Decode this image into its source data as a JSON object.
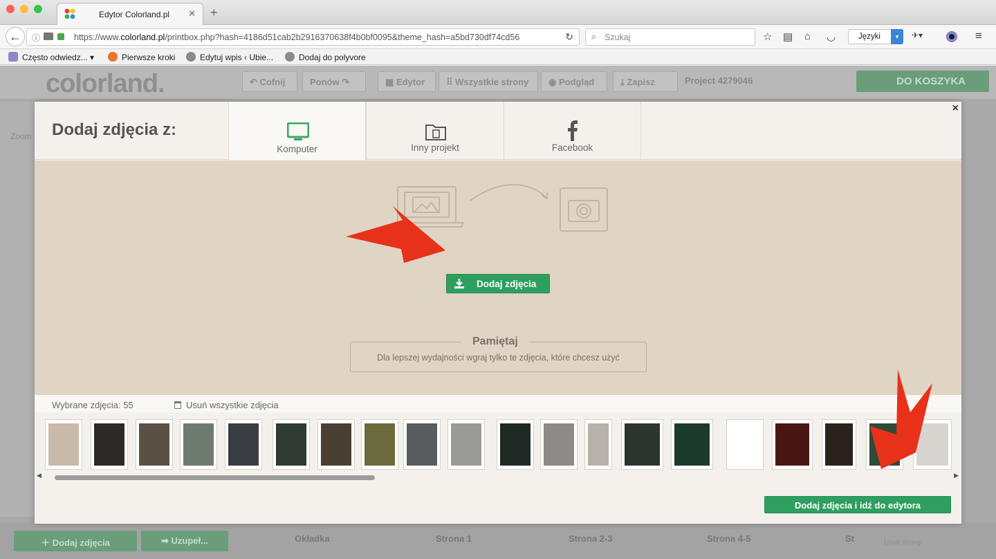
{
  "browser": {
    "tab_title": "Edytor Colorland.pl",
    "url_prefix": "https://www.",
    "url_host": "colorland.pl",
    "url_rest": "/printbox.php?hash=4186d51cab2b2916370638f4b0bf0095&theme_hash=a5bd730df74cd56",
    "search_placeholder": "Szukaj",
    "language": "Języki"
  },
  "bookmarks": [
    {
      "label": "Często odwiedz...",
      "icon": "folder-icon"
    },
    {
      "label": "Pierwsze kroki",
      "icon": "firefox-icon"
    },
    {
      "label": "Edytuj wpis ‹ Ubie...",
      "icon": "globe-icon"
    },
    {
      "label": "Dodaj do polyvore",
      "icon": "globe-icon"
    }
  ],
  "app": {
    "logo": "colorland.",
    "undo": "Cofnij",
    "redo": "Ponów",
    "editor": "Edytor",
    "all_pages": "Wszystkie strony",
    "preview": "Podgląd",
    "save": "Zapisz",
    "project": "Project 4279046",
    "cart": "DO KOSZYKA",
    "zoom_fragment": "Zoom",
    "add_photos": "Dodaj zdjęcia",
    "fill": "Uzupeł...",
    "pages": [
      "Okładka",
      "Strona 1",
      "Strona 2-3",
      "Strona 4-5",
      "St"
    ],
    "remove_page": "Usuń stronę"
  },
  "modal": {
    "title": "Dodaj zdjęcia z:",
    "tabs": [
      {
        "label": "Komputer",
        "icon": "monitor-icon"
      },
      {
        "label": "Inny projekt",
        "icon": "folder-icon"
      },
      {
        "label": "Facebook",
        "icon": "facebook-icon"
      }
    ],
    "add_button": "Dodaj zdjęcia",
    "remember_title": "Pamiętaj",
    "remember_text": "Dla lepszej wydajności wgraj tylko te zdjęcia, które chcesz użyć",
    "selected_label": "Wybrane zdjęcia: 55",
    "clear_label": "Usuń wszystkie zdjęcia",
    "go_button": "Dodaj zdjęcia i idź do edytora",
    "close": "×"
  },
  "thumbnails": [
    {
      "name": "photo-portrait-blonde",
      "color": "#c9b9a8"
    },
    {
      "name": "photo-portrait-dark",
      "color": "#2c2a29"
    },
    {
      "name": "photo-street-green",
      "color": "#5a5046"
    },
    {
      "name": "photo-street-coat",
      "color": "#6d7a70"
    },
    {
      "name": "photo-interior-dark",
      "color": "#3a3d42"
    },
    {
      "name": "photo-woman-bag",
      "color": "#2f3b33"
    },
    {
      "name": "photo-cafe-night",
      "color": "#4a4032"
    },
    {
      "name": "photo-woman-autumn",
      "color": "#6b6a3c"
    },
    {
      "name": "photo-woman-street",
      "color": "#585c5e"
    },
    {
      "name": "photo-interior-light",
      "color": "#9a9a96"
    },
    {
      "name": "photo-dark-gold",
      "color": "#1f2a24"
    },
    {
      "name": "photo-woman-grey",
      "color": "#8d8a88"
    },
    {
      "name": "photo-woman-black",
      "color": "#b6b2aa"
    },
    {
      "name": "photo-greenhouse",
      "color": "#2d3530"
    },
    {
      "name": "photo-palette-green",
      "color": "#1d3a2c"
    },
    {
      "name": "photo-silhouette",
      "color": "#ffffff"
    },
    {
      "name": "photo-red-room",
      "color": "#4a1614"
    },
    {
      "name": "photo-dark-hat",
      "color": "#2a221c"
    },
    {
      "name": "photo-plants",
      "color": "#2f4a36"
    },
    {
      "name": "photo-woman-white",
      "color": "#d8d4cf"
    }
  ],
  "colors": {
    "accent": "#2e9f5f",
    "drop_bg": "#e0d4c5",
    "arrow": "#e8311a"
  }
}
